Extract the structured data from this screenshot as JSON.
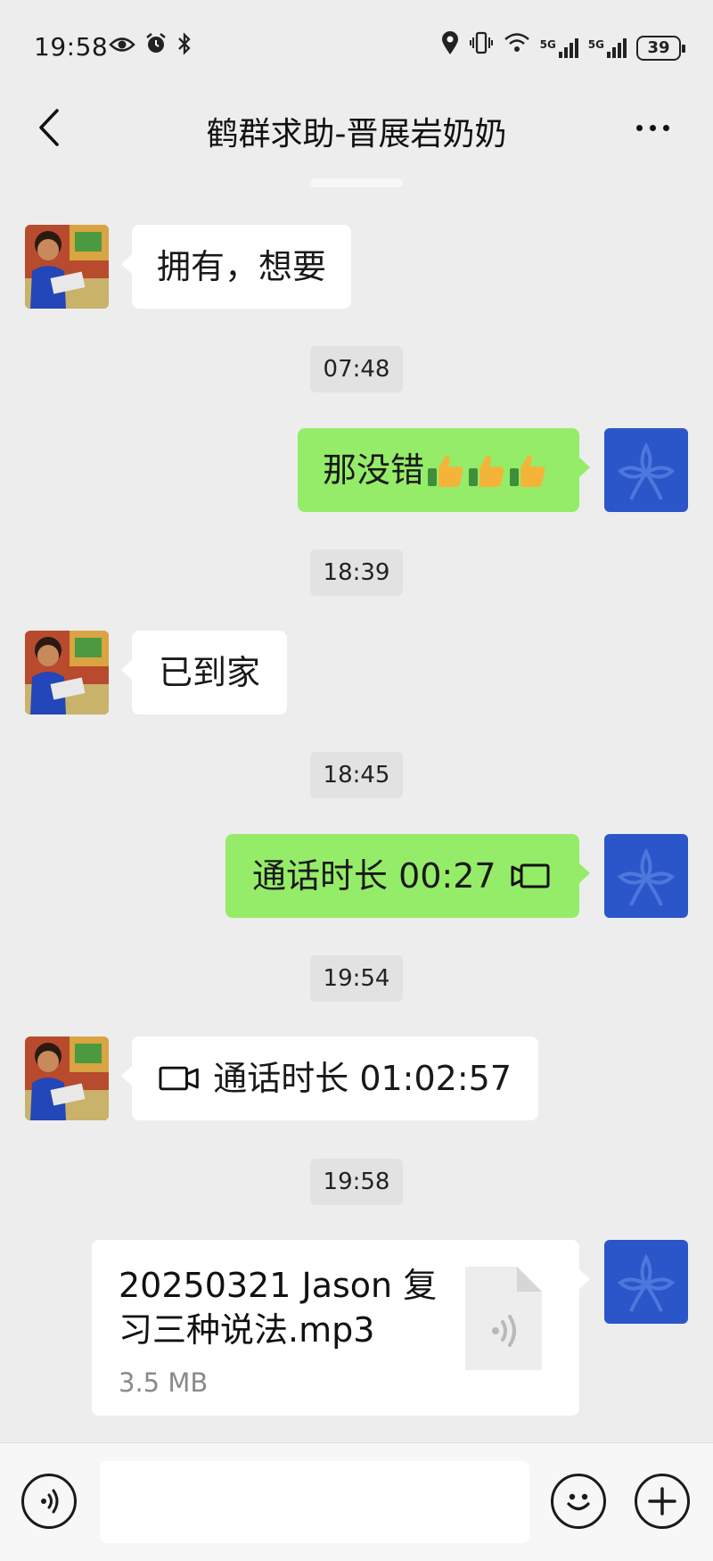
{
  "status_bar": {
    "time": "19:58",
    "network_label_1": "5G",
    "network_label_2": "5G",
    "battery": "39",
    "icons": [
      "eye-icon",
      "alarm-icon",
      "bluetooth-icon",
      "location-icon",
      "vibrate-icon",
      "wifi-icon",
      "signal-icon",
      "signal-icon",
      "battery-icon"
    ]
  },
  "header": {
    "title": "鹤群求助-晋展岩奶奶"
  },
  "messages": [
    {
      "direction": "in",
      "type": "text",
      "text": "拥有，想要"
    },
    {
      "type": "timestamp",
      "text": "07:48"
    },
    {
      "direction": "out",
      "type": "text",
      "text": "那没错",
      "emoji": [
        "thumbs-up",
        "thumbs-up",
        "thumbs-up"
      ]
    },
    {
      "type": "timestamp",
      "text": "18:39"
    },
    {
      "direction": "in",
      "type": "text",
      "text": "已到家"
    },
    {
      "type": "timestamp",
      "text": "18:45"
    },
    {
      "direction": "out",
      "type": "call",
      "text": "通话时长 00:27",
      "icon": "video-call-icon"
    },
    {
      "type": "timestamp",
      "text": "19:54"
    },
    {
      "direction": "in",
      "type": "call",
      "text": "通话时长 01:02:57",
      "icon": "video-call-icon"
    },
    {
      "type": "timestamp",
      "text": "19:58"
    },
    {
      "direction": "out",
      "type": "file",
      "file_name": "20250321 Jason 复习三种说法.mp3",
      "file_size": "3.5 MB",
      "icon": "audio-file-icon"
    }
  ],
  "input_bar": {
    "voice_icon": "voice-mode-icon",
    "emoji_icon": "emoji-icon",
    "plus_icon": "plus-icon",
    "value": ""
  },
  "colors": {
    "background": "#ededed",
    "outgoing_bubble": "#95ec69",
    "incoming_bubble": "#ffffff",
    "sender_avatar": "#2b56c9"
  }
}
